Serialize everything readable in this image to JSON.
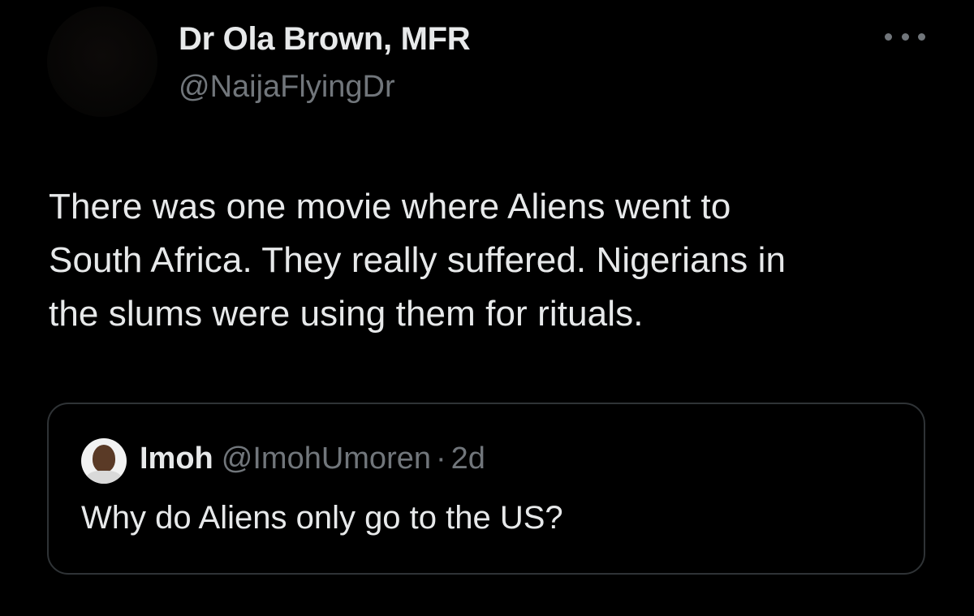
{
  "author": {
    "display_name": "Dr Ola Brown, MFR",
    "handle": "@NaijaFlyingDr"
  },
  "more_icon": "more-horizontal-icon",
  "tweet": {
    "lines": [
      "There was one movie where Aliens went to",
      "South Africa. They really suffered. Nigerians in",
      "the slums were using them for rituals."
    ]
  },
  "quoted_tweet": {
    "display_name": "Imoh",
    "handle": "@ImohUmoren",
    "separator": "·",
    "time": "2d",
    "text": "Why do Aliens only go to the US?"
  },
  "colors": {
    "background": "#000000",
    "primary_text": "#e7e9ea",
    "secondary_text": "#71767b",
    "border": "#2f3336"
  }
}
